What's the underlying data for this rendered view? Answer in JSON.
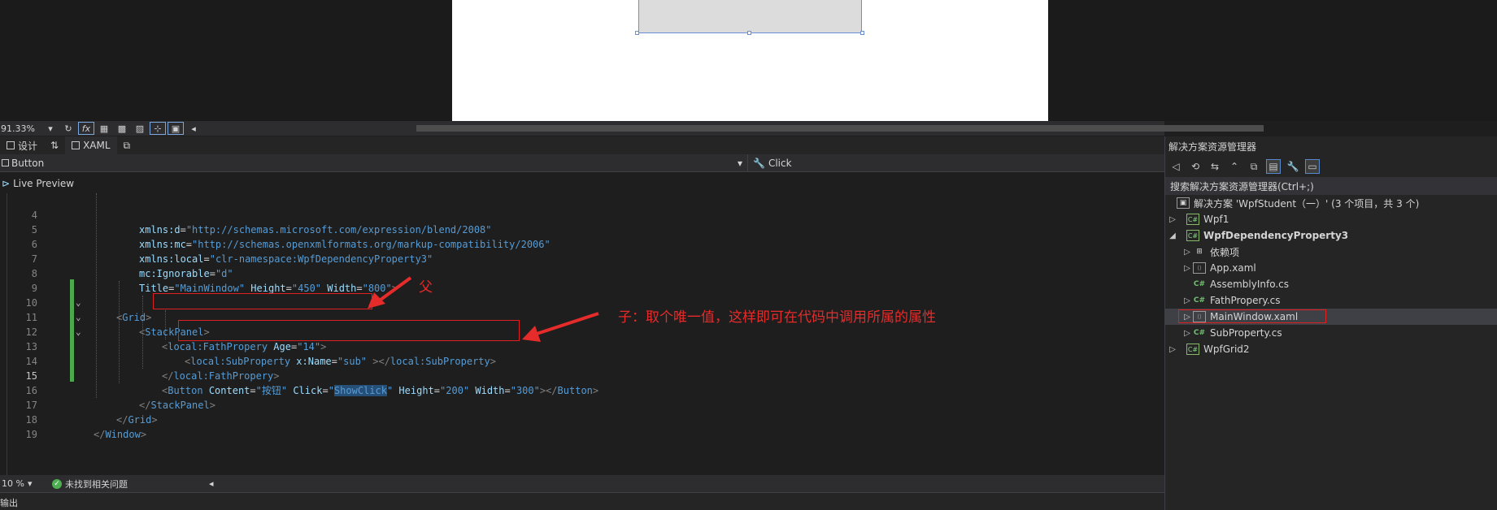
{
  "toolbar": {
    "zoom": "91.33%",
    "fx_label": "fx"
  },
  "tabs": [
    {
      "label": "设计"
    },
    {
      "label": "XAML"
    }
  ],
  "navbar": {
    "element": "Button",
    "event": "Click"
  },
  "live_preview_label": "Live Preview",
  "code": {
    "lines": [
      {
        "n": "4"
      },
      {
        "n": "5"
      },
      {
        "n": "6"
      },
      {
        "n": "7"
      },
      {
        "n": "8"
      },
      {
        "n": "9"
      },
      {
        "n": "10"
      },
      {
        "n": "11"
      },
      {
        "n": "12"
      },
      {
        "n": "13"
      },
      {
        "n": "14"
      },
      {
        "n": "15"
      },
      {
        "n": "16"
      },
      {
        "n": "17"
      },
      {
        "n": "18"
      },
      {
        "n": "19"
      }
    ],
    "l4": {
      "attr": "xmlns:d",
      "eq": "=",
      "val": "\"http://schemas.microsoft.com/expression/blend/2008\""
    },
    "l5": {
      "attr": "xmlns:mc",
      "eq": "=",
      "val": "\"http://schemas.openxmlformats.org/markup-compatibility/2006\""
    },
    "l6": {
      "attr": "xmlns:local",
      "eq": "=",
      "val": "\"clr-namespace:WpfDependencyProperty3\""
    },
    "l7": {
      "attr": "mc:Ignorable",
      "eq": "=",
      "val": "\"d\""
    },
    "l8": {
      "a1": "Title",
      "v1": "\"MainWindow\"",
      "a2": "Height",
      "v2": "\"450\"",
      "a3": "Width",
      "v3": "\"800\"",
      "end": ">"
    },
    "l9": {
      "open": "<",
      "tag": "Grid",
      "close": ">"
    },
    "l10": {
      "open": "<",
      "tag": "StackPanel",
      "close": ">"
    },
    "l11": {
      "open": "<",
      "tag": "local:FathPropery",
      "attr": "Age",
      "val": "\"14\"",
      "close": ">"
    },
    "l13": {
      "open": "<",
      "tag": "local:SubProperty",
      "attr": "x:Name",
      "val": "\"sub\"",
      "mid": " ></",
      "tag2": "local:SubProperty",
      "close": ">"
    },
    "l14": {
      "open": "</",
      "tag": "local:FathPropery",
      "close": ">"
    },
    "l15": {
      "open": "<",
      "tag": "Button",
      "a1": "Content",
      "v1": "\"按钮\"",
      "a2": "Click",
      "v2q1": "\"",
      "v2": "ShowClick",
      "v2q2": "\"",
      "a3": "Height",
      "v3": "\"200\"",
      "a4": "Width",
      "v4": "\"300\"",
      "mid": "></",
      "tag2": "Button",
      "close": ">"
    },
    "l16": {
      "open": "</",
      "tag": "StackPanel",
      "close": ">"
    },
    "l17": {
      "open": "</",
      "tag": "Grid",
      "close": ">"
    },
    "l18": {
      "open": "</",
      "tag": "Window",
      "close": ">"
    }
  },
  "annotations": {
    "parent": "父",
    "child": "子：取个唯一值，这样即可在代码中调用所属的属性",
    "color": "#e62b2b"
  },
  "status": {
    "zoom": "10 %",
    "issues": "未找到相关问题"
  },
  "output_label": "输出",
  "solution_explorer": {
    "title": "解决方案资源管理器",
    "search_placeholder": "搜索解决方案资源管理器(Ctrl+;)",
    "solution": "解决方案 'WpfStudent（一）' (3 个项目，共 3 个)",
    "items": [
      {
        "label": "Wpf1"
      },
      {
        "label": "WpfDependencyProperty3"
      },
      {
        "label": "依赖项"
      },
      {
        "label": "App.xaml"
      },
      {
        "label": "AssemblyInfo.cs"
      },
      {
        "label": "FathPropery.cs"
      },
      {
        "label": "MainWindow.xaml"
      },
      {
        "label": "SubProperty.cs"
      },
      {
        "label": "WpfGrid2"
      }
    ]
  },
  "colors": {
    "accent_blue": "#569cd6",
    "attr_color": "#9cdcfe",
    "change_green": "#4ca84c",
    "annotation_red": "#e62b2b"
  }
}
